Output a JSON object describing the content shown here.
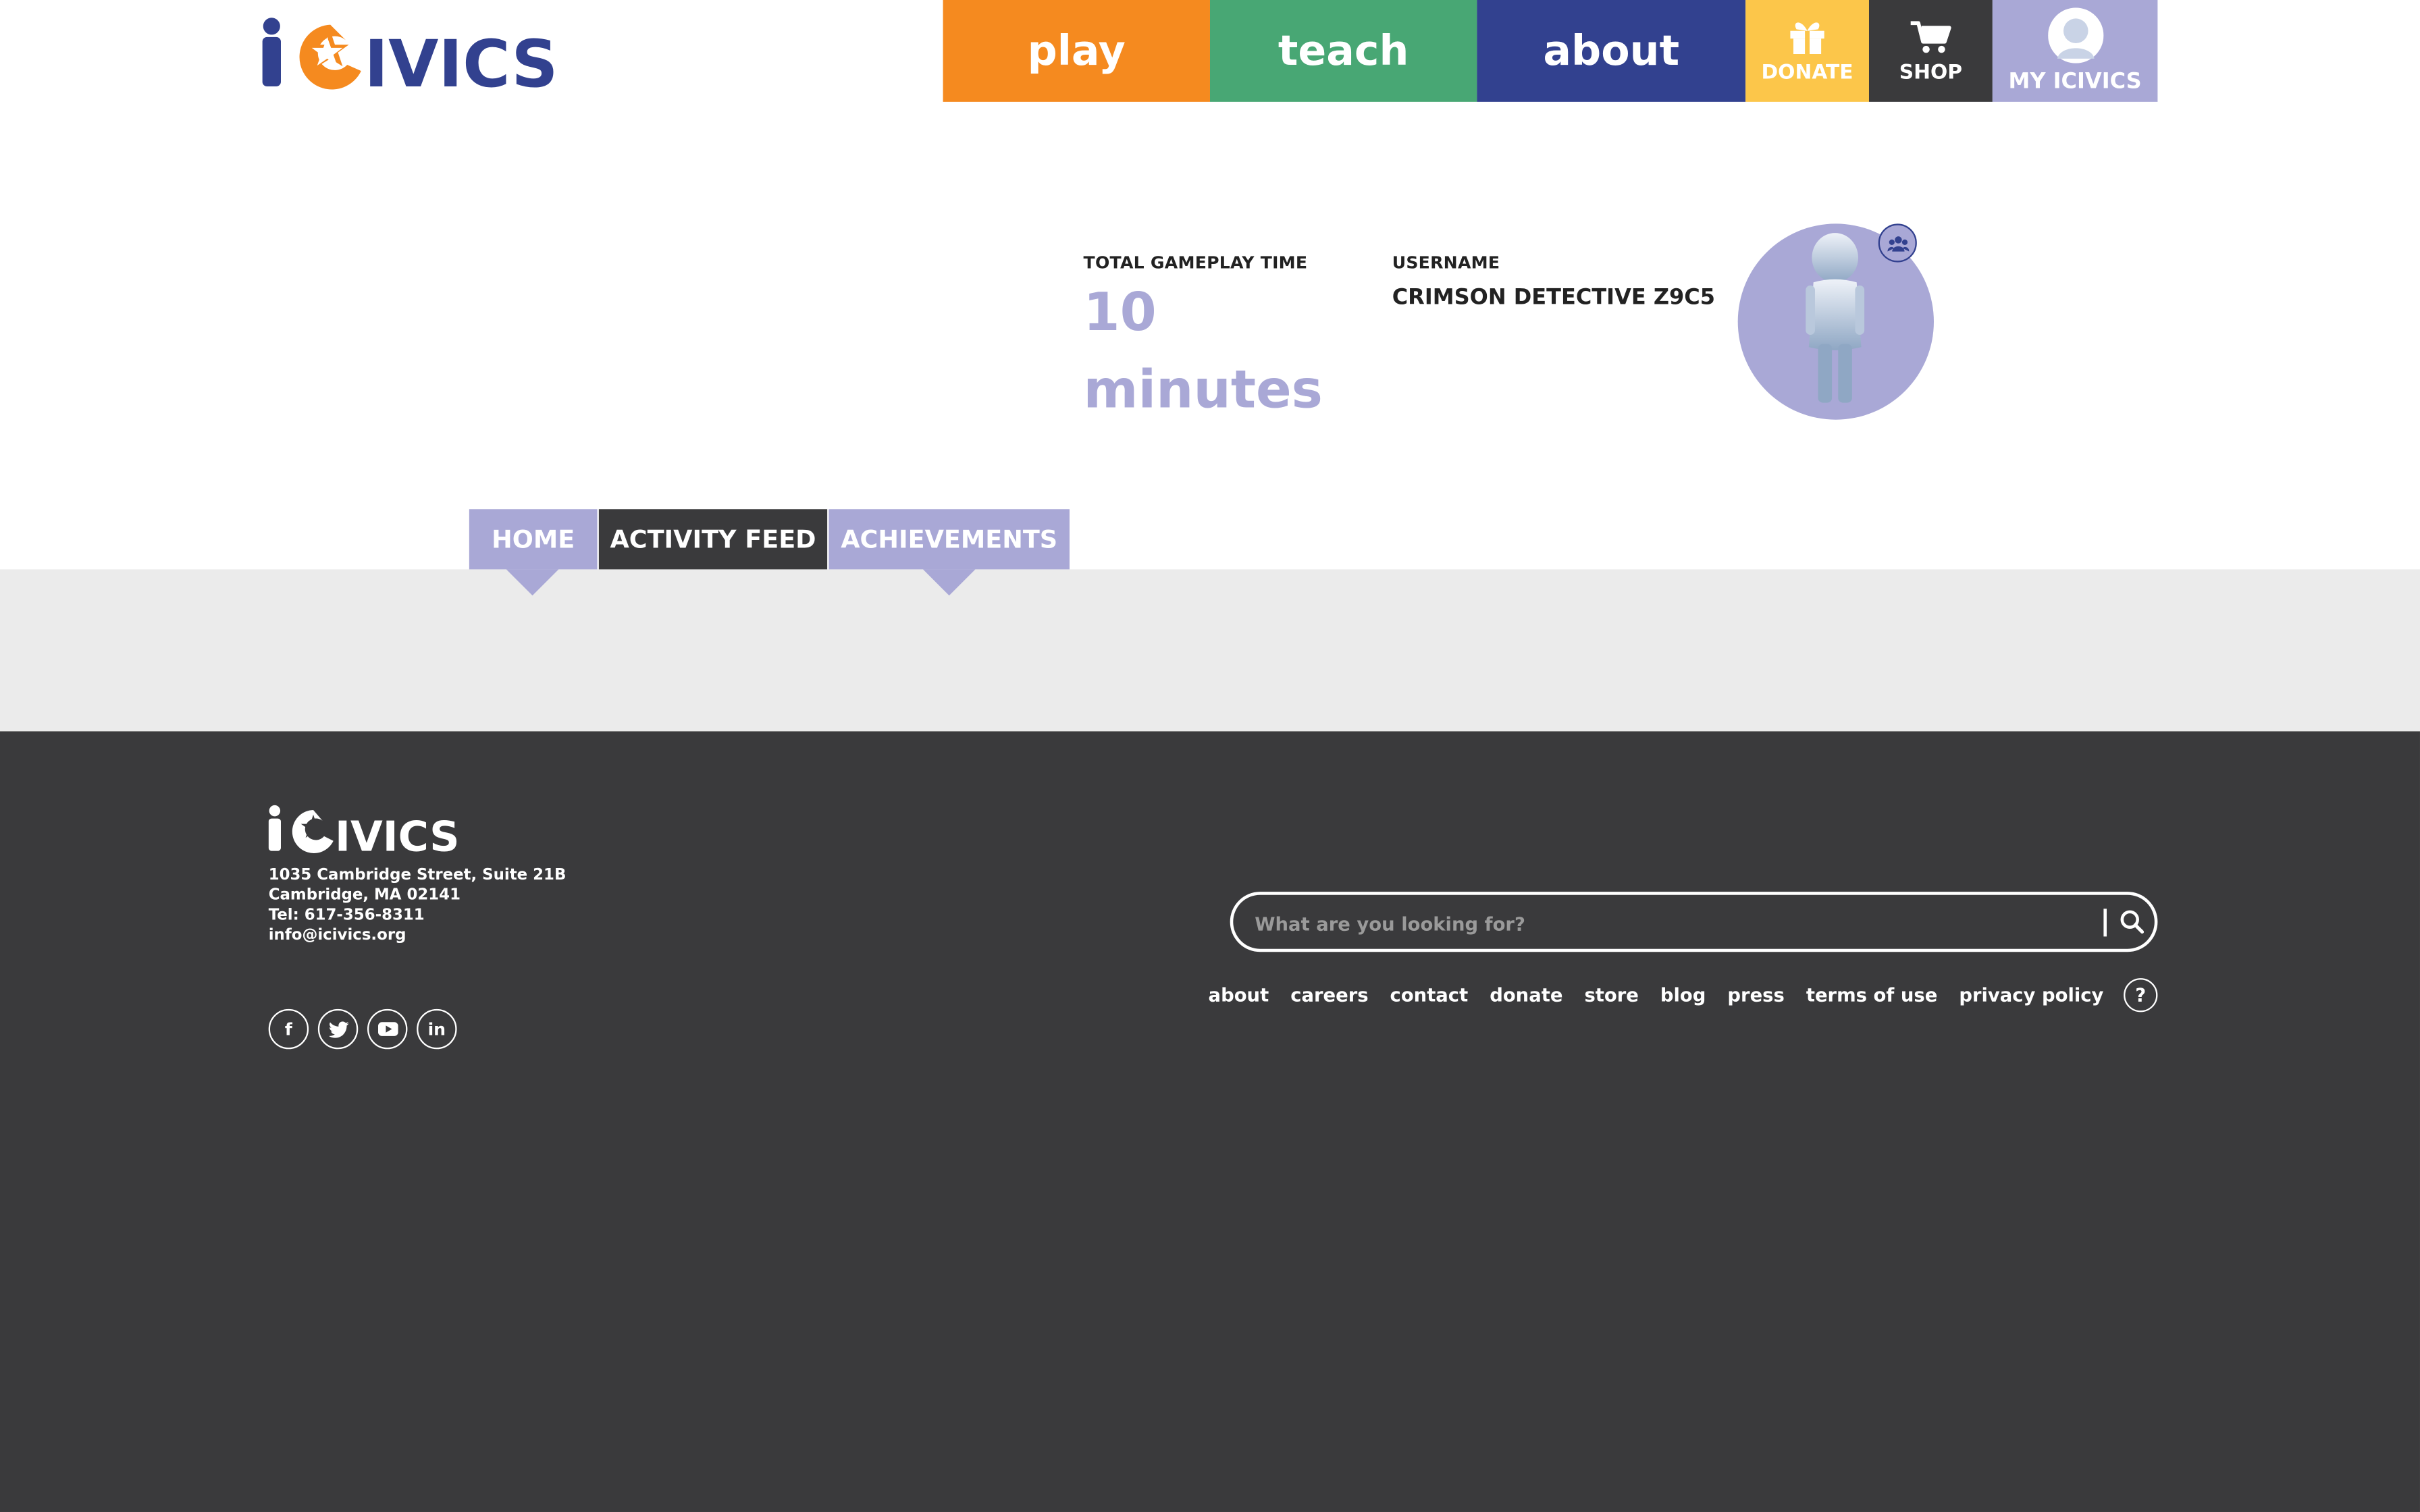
{
  "brand": {
    "logo_text": "iCivics",
    "orange": "#f58a1f",
    "navy": "#32418f",
    "green": "#48a774",
    "lavender": "#a9a8d6",
    "yellow": "#fcc64a",
    "dark": "#3a3a3c"
  },
  "nav": {
    "play": "play",
    "teach": "teach",
    "about": "about",
    "donate": {
      "label": "DONATE",
      "icon": "gift-icon"
    },
    "shop": {
      "label": "SHOP",
      "icon": "cart-icon"
    },
    "my": {
      "label": "MY ICIVICS",
      "icon": "avatar-icon"
    }
  },
  "profile": {
    "gameplay_label": "TOTAL GAMEPLAY TIME",
    "gameplay_value": "10",
    "gameplay_unit": "minutes",
    "username_label": "USERNAME",
    "username": "CRIMSON DETECTIVE Z9C5"
  },
  "tabs": [
    {
      "label": "HOME"
    },
    {
      "label": "ACTIVITY FEED"
    },
    {
      "label": "ACHIEVEMENTS"
    }
  ],
  "footer": {
    "address": [
      "1035 Cambridge Street, Suite 21B",
      "Cambridge, MA 02141",
      "Tel: 617-356-8311",
      "info@icivics.org"
    ],
    "social": [
      "facebook-icon",
      "twitter-icon",
      "youtube-icon",
      "linkedin-icon"
    ],
    "search_placeholder": "What are you looking for?",
    "links": [
      "about",
      "careers",
      "contact",
      "donate",
      "store",
      "blog",
      "press",
      "terms of use",
      "privacy policy"
    ],
    "help": "?"
  }
}
